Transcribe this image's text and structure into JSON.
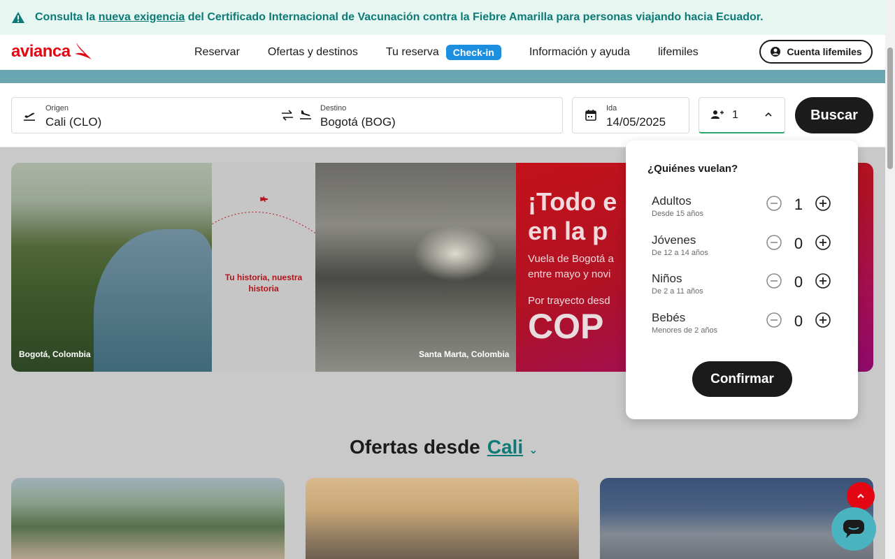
{
  "alert": {
    "text_before": "Consulta la ",
    "link": "nueva exigencia",
    "text_after": " del Certificado Internacional de Vacunación contra la Fiebre Amarilla para personas viajando hacia Ecuador."
  },
  "header": {
    "logo": "avianca",
    "nav": [
      "Reservar",
      "Ofertas y destinos",
      "Tu reserva",
      "Información y ayuda",
      "lifemiles"
    ],
    "checkin": "Check-in",
    "account": "Cuenta lifemiles"
  },
  "search": {
    "origin_label": "Origen",
    "origin_value": "Cali  (CLO)",
    "destination_label": "Destino",
    "destination_value": "Bogotá  (BOG)",
    "date_label": "Ida",
    "date_value": "14/05/2025",
    "passengers": "1",
    "search_button": "Buscar"
  },
  "banner": {
    "caption_left": "Bogotá, Colombia",
    "tagline": "Tu historia, nuestra historia",
    "caption_right": "Santa Marta, Colombia",
    "headline_1": "¡Todo e",
    "headline_2": "en la p",
    "line_1": "Vuela de Bogotá a",
    "line_2": "entre mayo y novi",
    "line_3": "Por trayecto desd",
    "price": "COP"
  },
  "offers": {
    "title": "Ofertas desde",
    "city": "Cali"
  },
  "passengers_popup": {
    "question": "¿Quiénes vuelan?",
    "rows": [
      {
        "name": "Adultos",
        "sub": "Desde 15 años",
        "count": "1"
      },
      {
        "name": "Jóvenes",
        "sub": "De 12 a 14 años",
        "count": "0"
      },
      {
        "name": "Niños",
        "sub": "De 2 a 11 años",
        "count": "0"
      },
      {
        "name": "Bebés",
        "sub": "Menores de 2 años",
        "count": "0"
      }
    ],
    "confirm": "Confirmar"
  },
  "colors": {
    "brand_red": "#e30613",
    "teal": "#0d7a77",
    "checkin_blue": "#1d8fe1",
    "dark": "#1b1b1b"
  },
  "icons": [
    "warning-icon",
    "avianca-bird-logo",
    "user-circle-icon",
    "takeoff-icon",
    "swap-icon",
    "landing-icon",
    "calendar-icon",
    "add-person-icon",
    "chevron-up-icon",
    "minus-circle-icon",
    "plus-circle-icon",
    "chevron-up-icon",
    "chat-icon"
  ]
}
